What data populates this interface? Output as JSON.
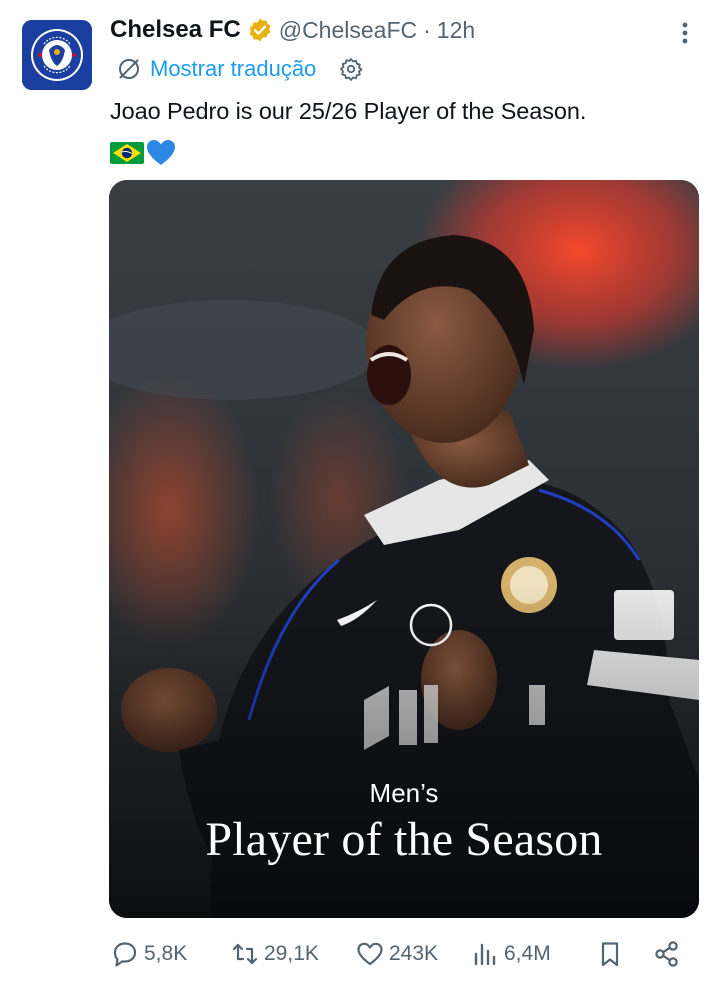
{
  "tweet": {
    "author_name": "Chelsea FC",
    "handle": "@ChelseaFC",
    "separator": "·",
    "time": "12h",
    "translate_label": "Mostrar tradução",
    "text": "Joao Pedro is our 25/26 Player of the Season.",
    "emojis": [
      "flag-brazil",
      "blue-heart"
    ],
    "verified_color": "#e8b10d"
  },
  "media": {
    "caption_small": "Men’s",
    "caption_big": "Player of the Season"
  },
  "actions": {
    "replies": "5,8K",
    "reposts": "29,1K",
    "likes": "243K",
    "views": "6,4M"
  },
  "colors": {
    "link": "#1d9bf0",
    "secondary": "#536471",
    "club_blue": "#1b3fa0"
  }
}
